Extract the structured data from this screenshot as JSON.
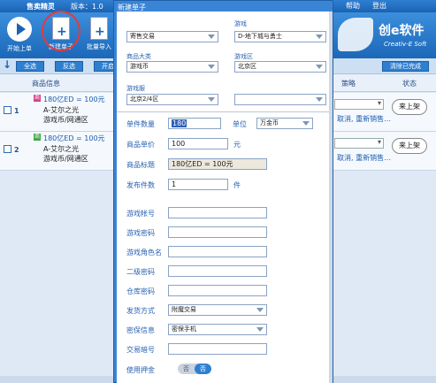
{
  "app": {
    "title": "售卖精灵",
    "version": "版本：1.0 ",
    "help": "帮助",
    "logout": "登出",
    "tools": {
      "start_label": "开始上单",
      "new_label": "新建单子",
      "batch_label": "批量导入"
    },
    "logo": {
      "name": "创e软件",
      "sub": "Creativ-E Soft"
    },
    "subbar": {
      "select_all": "全选",
      "invert": "反选",
      "start": "开启",
      "clear_done": "清除已完成"
    },
    "headers": {
      "info": "商品信息",
      "strategy": "策略",
      "status": "状态"
    },
    "orders": [
      {
        "index": "1",
        "tag": "商",
        "tag_color": "#d6408b",
        "title": "180亿ED = 100元",
        "who": "A-艾尔之光",
        "game": "游戏币/网通区",
        "action": "取消, 重新销售…",
        "status": "来上架"
      },
      {
        "index": "2",
        "tag": "商",
        "tag_color": "#3fa843",
        "title": "180亿ED = 100元",
        "who": "A-艾尔之光",
        "game": "游戏币/网通区",
        "action": "取消, 重新销售…",
        "status": "来上架"
      }
    ]
  },
  "modal": {
    "title": "新建单子",
    "trade_mode": "寄售交易",
    "game_label": "游戏",
    "game_value": "D-地下城与勇士",
    "category_label": "商品大类",
    "category_value": "游戏币",
    "region_label": "游戏区",
    "region_value": "北京区",
    "server_label": "游戏服",
    "server_value": "北京2/4区",
    "extra_value": "",
    "qty_label": "单件数量",
    "qty_value": "180",
    "unit_label": "单位",
    "unit_value": "万金币",
    "price_label": "商品单价",
    "price_value": "100",
    "price_unit": "元",
    "item_title_label": "商品标题",
    "item_title_value": "180亿ED = 100元",
    "count_label": "发布件数",
    "count_value": "1",
    "count_unit": "件",
    "account_label": "游戏帐号",
    "password_label": "游戏密码",
    "role_label": "游戏角色名",
    "pw2_label": "二级密码",
    "storage_label": "仓库密码",
    "ship_label": "发货方式",
    "ship_value": "附魔交易",
    "secure_label": "密保信息",
    "secure_value": "密保手机",
    "trade_pw_label": "交易暗号",
    "deposit_label": "使用押金",
    "toggle_off": "否",
    "toggle_on": "否"
  }
}
